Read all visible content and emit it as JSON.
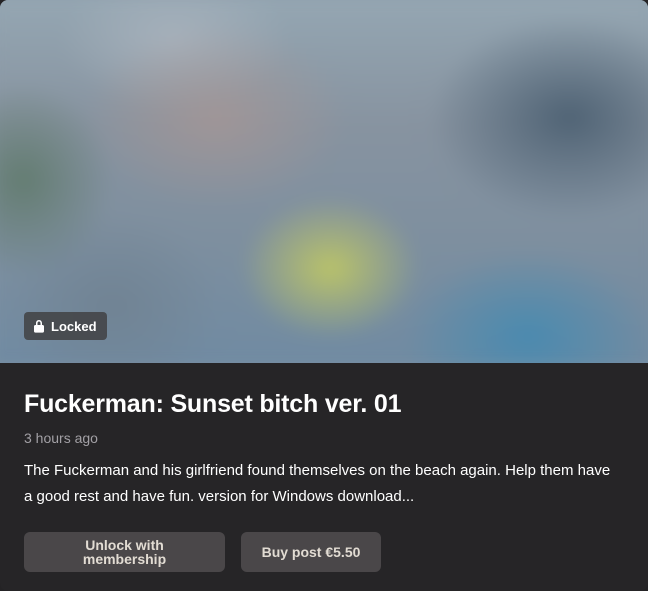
{
  "card": {
    "badge": {
      "label": "Locked",
      "icon": "lock-icon"
    },
    "title": "Fuckerman: Sunset bitch ver. 01",
    "time": "3 hours ago",
    "description": "The Fuckerman and his girlfriend found themselves on the beach again. Help them have a good rest and have fun. version for Windows download...",
    "actions": {
      "membership": "Unlock with membership",
      "buy": "Buy post €5.50"
    }
  },
  "colors": {
    "background": "#262527",
    "text": "#ffffff",
    "muted_text": "#a2a0a5",
    "button_background": "#4a4749",
    "button_text": "#e2dcd3",
    "badge_background": "#44464a"
  }
}
